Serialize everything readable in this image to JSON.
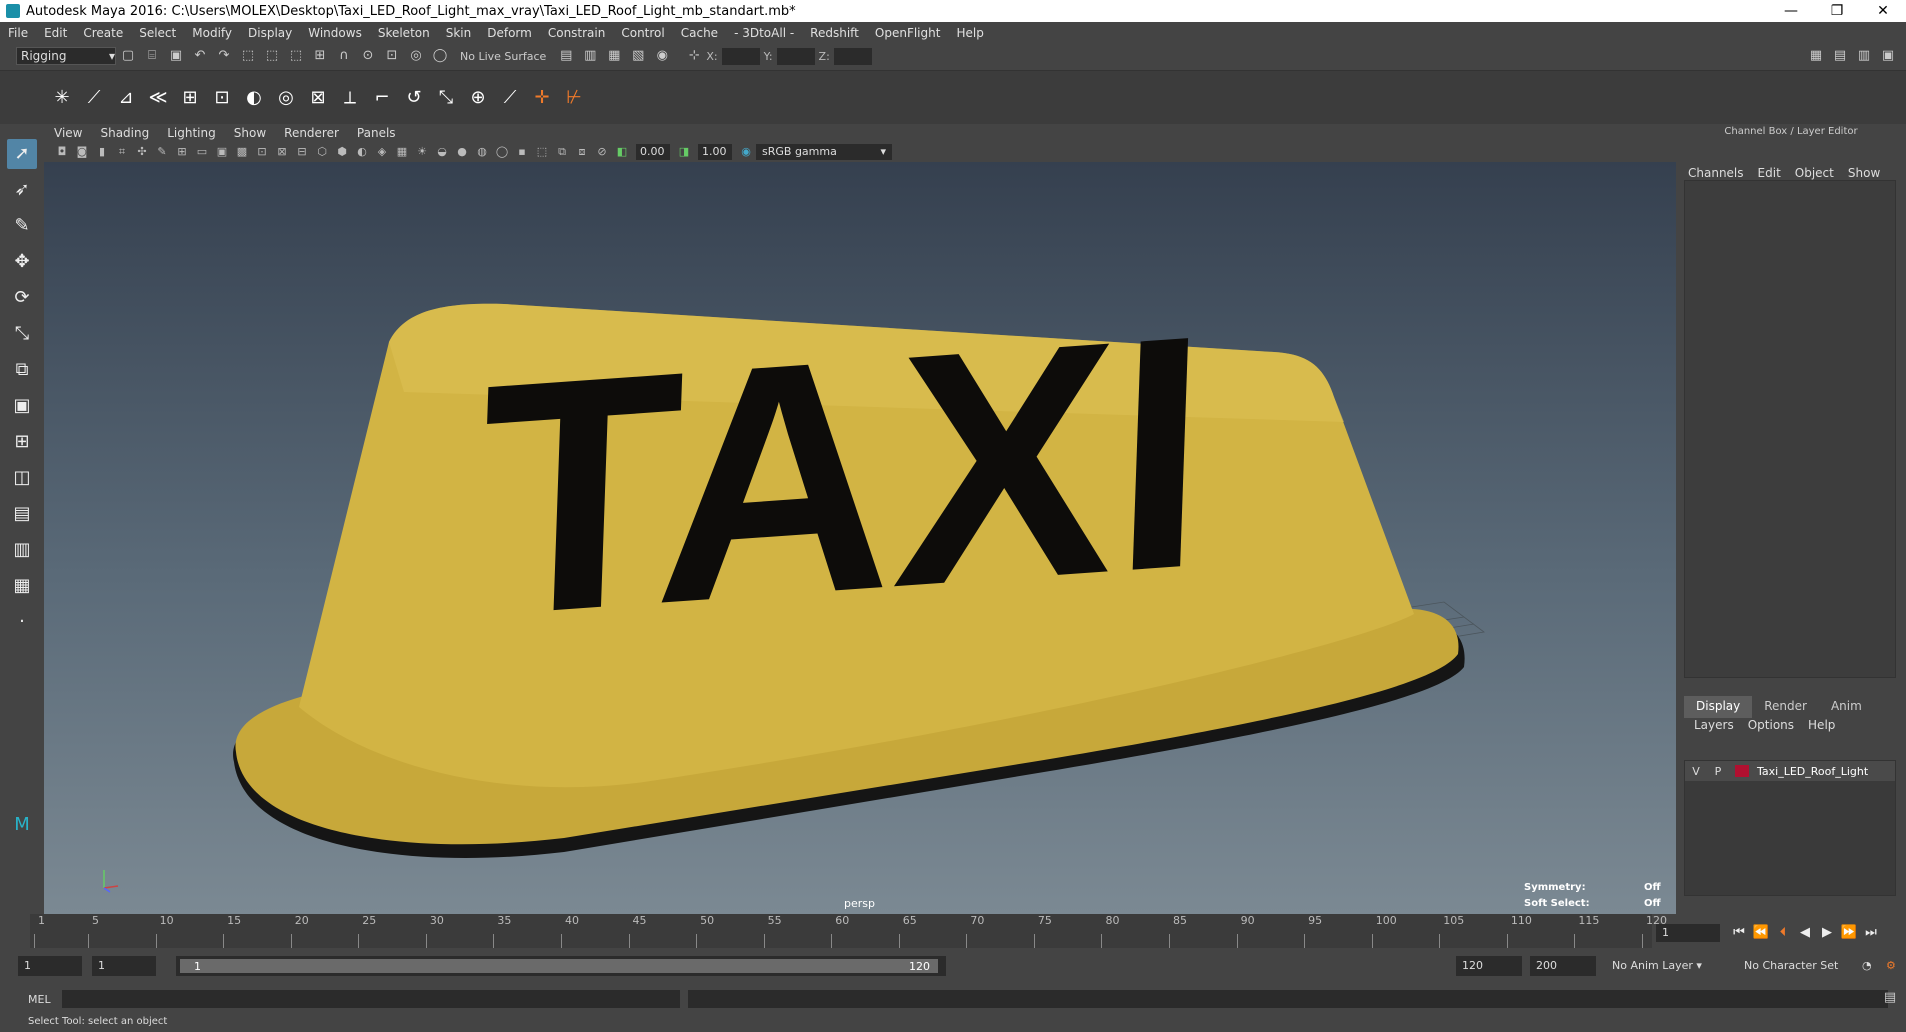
{
  "window": {
    "title": "Autodesk Maya 2016: C:\\Users\\MOLEX\\Desktop\\Taxi_LED_Roof_Light_max_vray\\Taxi_LED_Roof_Light_mb_standart.mb*",
    "minimize": "—",
    "restore": "❐",
    "close": "✕"
  },
  "menubar": [
    "File",
    "Edit",
    "Create",
    "Select",
    "Modify",
    "Display",
    "Windows",
    "Skeleton",
    "Skin",
    "Deform",
    "Constrain",
    "Control",
    "Cache",
    "- 3DtoAll -",
    "Redshift",
    "OpenFlight",
    "Help"
  ],
  "statusline": {
    "mode": "Rigging",
    "live_surface": "No Live Surface",
    "x_label": "X:",
    "y_label": "Y:",
    "z_label": "Z:"
  },
  "panel": {
    "menu": [
      "View",
      "Shading",
      "Lighting",
      "Show",
      "Renderer",
      "Panels"
    ],
    "exposure": "0.00",
    "gamma_value": "1.00",
    "color_space": "sRGB gamma"
  },
  "viewport": {
    "camera": "persp",
    "taxi_text": "TAXI",
    "symmetry_label": "Symmetry:",
    "symmetry_value": "Off",
    "soft_select_label": "Soft Select:",
    "soft_select_value": "Off"
  },
  "channelbox": {
    "title": "Channel Box / Layer Editor",
    "tabs": [
      "Channels",
      "Edit",
      "Object",
      "Show"
    ],
    "layer_tabs": [
      "Display",
      "Render",
      "Anim"
    ],
    "layer_menu": [
      "Layers",
      "Options",
      "Help"
    ],
    "layer": {
      "v": "V",
      "p": "P",
      "name": "Taxi_LED_Roof_Light",
      "color": "#b01030"
    }
  },
  "timeline": {
    "ticks": [
      "1",
      "5",
      "10",
      "15",
      "20",
      "25",
      "30",
      "35",
      "40",
      "45",
      "50",
      "55",
      "60",
      "65",
      "70",
      "75",
      "80",
      "85",
      "90",
      "95",
      "100",
      "105",
      "110",
      "115",
      "120"
    ],
    "current_frame": "1"
  },
  "range": {
    "start": "1",
    "anim_start": "1",
    "slider_start": "1",
    "slider_end": "120",
    "end": "120",
    "anim_end": "200",
    "anim_layer": "No Anim Layer",
    "character_set": "No Character Set"
  },
  "command": {
    "mel_label": "MEL",
    "help": "Select Tool: select an object"
  }
}
